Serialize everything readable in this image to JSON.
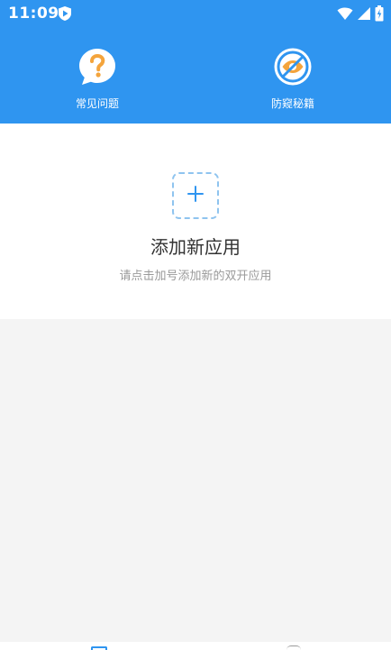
{
  "status_bar": {
    "time": "11:09",
    "icons": [
      "shield-play-icon",
      "wifi-icon",
      "signal-icon",
      "battery-icon"
    ]
  },
  "quick_actions": [
    {
      "label": "常见问题",
      "icon": "question-bubble-icon"
    },
    {
      "label": "防窥秘籍",
      "icon": "eye-slash-icon"
    }
  ],
  "empty_state": {
    "icon": "plus-icon",
    "title": "添加新应用",
    "subtitle": "请点击加号添加新的双开应用"
  },
  "colors": {
    "primary": "#2f95f0",
    "accent_orange": "#f4a43c",
    "background": "#f4f4f4"
  }
}
